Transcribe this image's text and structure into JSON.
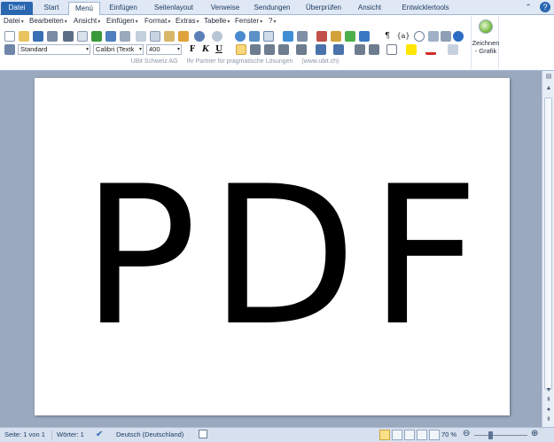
{
  "ribbon_tabs": [
    {
      "label": "Datei"
    },
    {
      "label": "Start"
    },
    {
      "label": "Menü"
    },
    {
      "label": "Einfügen"
    },
    {
      "label": "Seitenlayout"
    },
    {
      "label": "Verweise"
    },
    {
      "label": "Sendungen"
    },
    {
      "label": "Überprüfen"
    },
    {
      "label": "Ansicht"
    },
    {
      "label": "Entwicklertools"
    }
  ],
  "menubar": {
    "items": [
      "Datei",
      "Bearbeiten",
      "Ansicht",
      "Einfügen",
      "Format",
      "Extras",
      "Tabelle",
      "Fenster",
      "?"
    ],
    "arrow": "▾"
  },
  "toolbar": {
    "style_value": "Standard",
    "font_value": "Calibri (Textk",
    "size_value": "400",
    "bold": "F",
    "italic": "K",
    "underline": "U",
    "pilcrow": "¶",
    "brace": "{a}"
  },
  "adline": {
    "company": "UBit Schweiz AG",
    "tagline": "Ihr Partner für pragmatische Lösungen",
    "url": "(www.ubit.ch)"
  },
  "zeichnen": {
    "line1": "Zeichnen",
    "line2": "- Grafik"
  },
  "document": {
    "text": "PDF"
  },
  "status": {
    "page": "Seite: 1 von 1",
    "words": "Wörter: 1",
    "language": "Deutsch (Deutschland)",
    "zoom": "70 %"
  },
  "colors": {
    "datei_tab": "#2a67b1",
    "doc_background": "#9aa9be",
    "highlight": "#ffe600",
    "font_color": "#d12a2a"
  }
}
